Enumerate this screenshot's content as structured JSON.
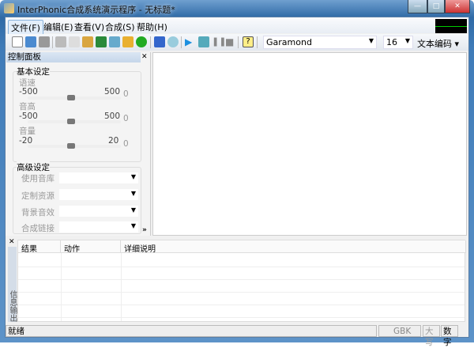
{
  "window": {
    "title": "InterPhonic合成系统演示程序 - 无标题*",
    "min": "—",
    "max": "□",
    "close": "✕"
  },
  "menu": [
    {
      "label": "文件(F)"
    },
    {
      "label": "编辑(E)"
    },
    {
      "label": "查看(V)"
    },
    {
      "label": "合成(S)"
    },
    {
      "label": "帮助(H)"
    }
  ],
  "toolbar": {
    "font": "Garamond",
    "size": "16",
    "encoding": "文本编码 ▾"
  },
  "panel": {
    "title": "控制面板",
    "basic": "基本设定",
    "sliders": [
      {
        "label": "语速",
        "min": "-500",
        "max": "500",
        "value": "0"
      },
      {
        "label": "音高",
        "min": "-500",
        "max": "500",
        "value": "0"
      },
      {
        "label": "音量",
        "min": "-20",
        "max": "20",
        "value": "0"
      }
    ],
    "advanced": "高级设定",
    "selects": [
      {
        "label": "使用音库"
      },
      {
        "label": "定制资源"
      },
      {
        "label": "背景音效"
      },
      {
        "label": "合成链接"
      }
    ]
  },
  "output": {
    "tab": "信息输出",
    "columns": [
      "结果",
      "动作",
      "详细说明"
    ]
  },
  "status": {
    "text": "就绪",
    "encoding": "GBK",
    "caps": "大写",
    "num": "数字"
  }
}
